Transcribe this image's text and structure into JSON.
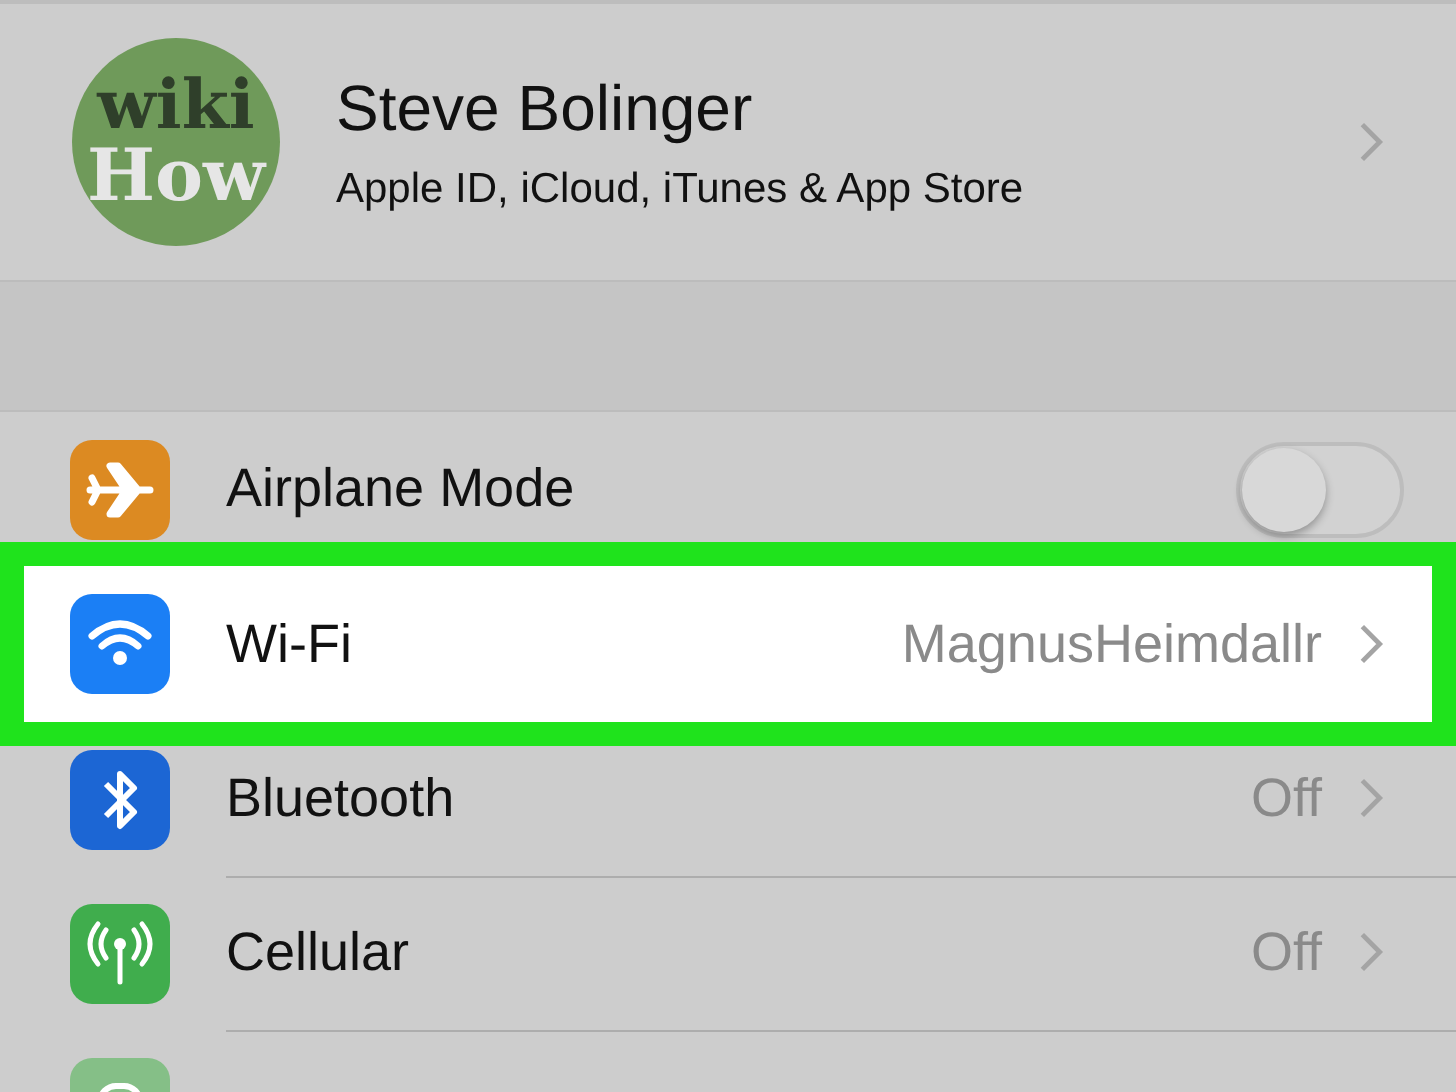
{
  "profile": {
    "avatar_lines": [
      "wiki",
      "How"
    ],
    "name": "Steve Bolinger",
    "subtitle": "Apple ID, iCloud, iTunes & App Store"
  },
  "settings": [
    {
      "kind": "toggle",
      "label": "Airplane Mode",
      "on": false,
      "highlighted": false
    },
    {
      "kind": "link",
      "label": "Wi-Fi",
      "value": "MagnusHeimdallr",
      "highlighted": true
    },
    {
      "kind": "link",
      "label": "Bluetooth",
      "value": "Off",
      "highlighted": false
    },
    {
      "kind": "link",
      "label": "Cellular",
      "value": "Off",
      "highlighted": false
    },
    {
      "kind": "partial",
      "highlighted": false
    }
  ]
}
